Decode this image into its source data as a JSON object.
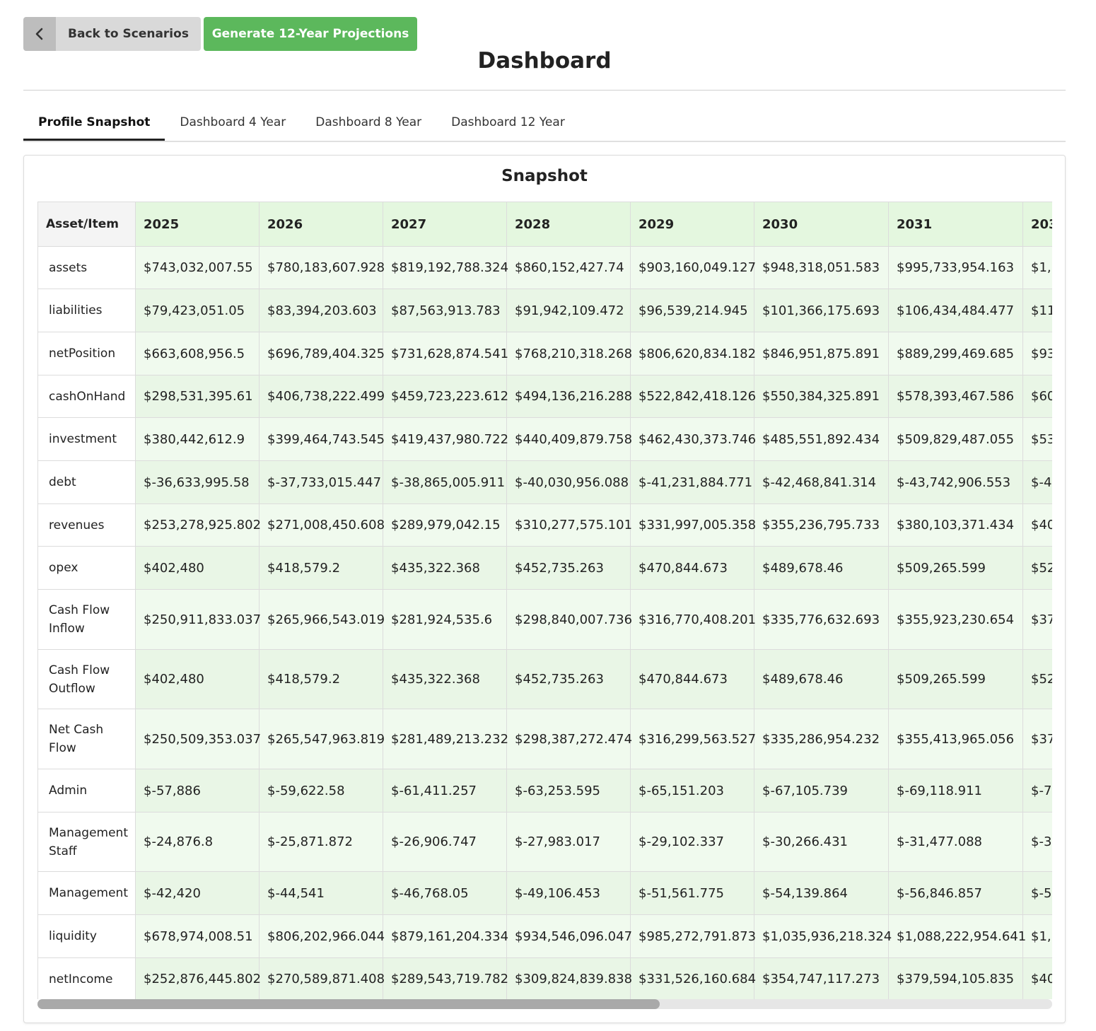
{
  "toolbar": {
    "back_label": "Back to Scenarios",
    "generate_label": "Generate 12-Year Projections"
  },
  "page": {
    "title": "Dashboard"
  },
  "tabs": [
    "Profile Snapshot",
    "Dashboard 4 Year",
    "Dashboard 8 Year",
    "Dashboard 12 Year"
  ],
  "active_tab": "Profile Snapshot",
  "snapshot": {
    "title": "Snapshot",
    "item_header": "Asset/Item",
    "years": [
      "2025",
      "2026",
      "2027",
      "2028",
      "2029",
      "2030",
      "2031",
      "203"
    ],
    "rows": [
      {
        "label": "assets",
        "values": [
          "$743,032,007.55",
          "$780,183,607.928",
          "$819,192,788.324",
          "$860,152,427.74",
          "$903,160,049.127",
          "$948,318,051.583",
          "$995,733,954.163",
          "$1,("
        ]
      },
      {
        "label": "liabilities",
        "values": [
          "$79,423,051.05",
          "$83,394,203.603",
          "$87,563,913.783",
          "$91,942,109.472",
          "$96,539,214.945",
          "$101,366,175.693",
          "$106,434,484.477",
          "$11"
        ]
      },
      {
        "label": "netPosition",
        "values": [
          "$663,608,956.5",
          "$696,789,404.325",
          "$731,628,874.541",
          "$768,210,318.268",
          "$806,620,834.182",
          "$846,951,875.891",
          "$889,299,469.685",
          "$93"
        ]
      },
      {
        "label": "cashOnHand",
        "values": [
          "$298,531,395.61",
          "$406,738,222.499",
          "$459,723,223.612",
          "$494,136,216.288",
          "$522,842,418.126",
          "$550,384,325.891",
          "$578,393,467.586",
          "$60"
        ]
      },
      {
        "label": "investment",
        "values": [
          "$380,442,612.9",
          "$399,464,743.545",
          "$419,437,980.722",
          "$440,409,879.758",
          "$462,430,373.746",
          "$485,551,892.434",
          "$509,829,487.055",
          "$53"
        ]
      },
      {
        "label": "debt",
        "values": [
          "$-36,633,995.58",
          "$-37,733,015.447",
          "$-38,865,005.911",
          "$-40,030,956.088",
          "$-41,231,884.771",
          "$-42,468,841.314",
          "$-43,742,906.553",
          "$-4!"
        ]
      },
      {
        "label": "revenues",
        "values": [
          "$253,278,925.802",
          "$271,008,450.608",
          "$289,979,042.15",
          "$310,277,575.101",
          "$331,997,005.358",
          "$355,236,795.733",
          "$380,103,371.434",
          "$40"
        ]
      },
      {
        "label": "opex",
        "values": [
          "$402,480",
          "$418,579.2",
          "$435,322.368",
          "$452,735.263",
          "$470,844.673",
          "$489,678.46",
          "$509,265.599",
          "$52"
        ]
      },
      {
        "label": "Cash Flow Inflow",
        "values": [
          "$250,911,833.037",
          "$265,966,543.019",
          "$281,924,535.6",
          "$298,840,007.736",
          "$316,770,408.201",
          "$335,776,632.693",
          "$355,923,230.654",
          "$37"
        ]
      },
      {
        "label": "Cash Flow Outflow",
        "values": [
          "$402,480",
          "$418,579.2",
          "$435,322.368",
          "$452,735.263",
          "$470,844.673",
          "$489,678.46",
          "$509,265.599",
          "$52"
        ]
      },
      {
        "label": "Net Cash Flow",
        "values": [
          "$250,509,353.037",
          "$265,547,963.819",
          "$281,489,213.232",
          "$298,387,272.474",
          "$316,299,563.527",
          "$335,286,954.232",
          "$355,413,965.056",
          "$37"
        ]
      },
      {
        "label": "Admin",
        "values": [
          "$-57,886",
          "$-59,622.58",
          "$-61,411.257",
          "$-63,253.595",
          "$-65,151.203",
          "$-67,105.739",
          "$-69,118.911",
          "$-7:"
        ]
      },
      {
        "label": "Management Staff",
        "values": [
          "$-24,876.8",
          "$-25,871.872",
          "$-26,906.747",
          "$-27,983.017",
          "$-29,102.337",
          "$-30,266.431",
          "$-31,477.088",
          "$-3:"
        ]
      },
      {
        "label": "Management",
        "values": [
          "$-42,420",
          "$-44,541",
          "$-46,768.05",
          "$-49,106.453",
          "$-51,561.775",
          "$-54,139.864",
          "$-56,846.857",
          "$-5!"
        ]
      },
      {
        "label": "liquidity",
        "values": [
          "$678,974,008.51",
          "$806,202,966.044",
          "$879,161,204.334",
          "$934,546,096.047",
          "$985,272,791.873",
          "$1,035,936,218.324",
          "$1,088,222,954.641",
          "$1,1"
        ]
      },
      {
        "label": "netIncome",
        "values": [
          "$252,876,445.802",
          "$270,589,871.408",
          "$289,543,719.782",
          "$309,824,839.838",
          "$331,526,160.684",
          "$354,747,117.273",
          "$379,594,105.835",
          "$40"
        ]
      }
    ]
  },
  "colors": {
    "accent_green": "#5cb85c",
    "header_green": "#e4f7df",
    "cell_green": "#e9f6e6"
  }
}
